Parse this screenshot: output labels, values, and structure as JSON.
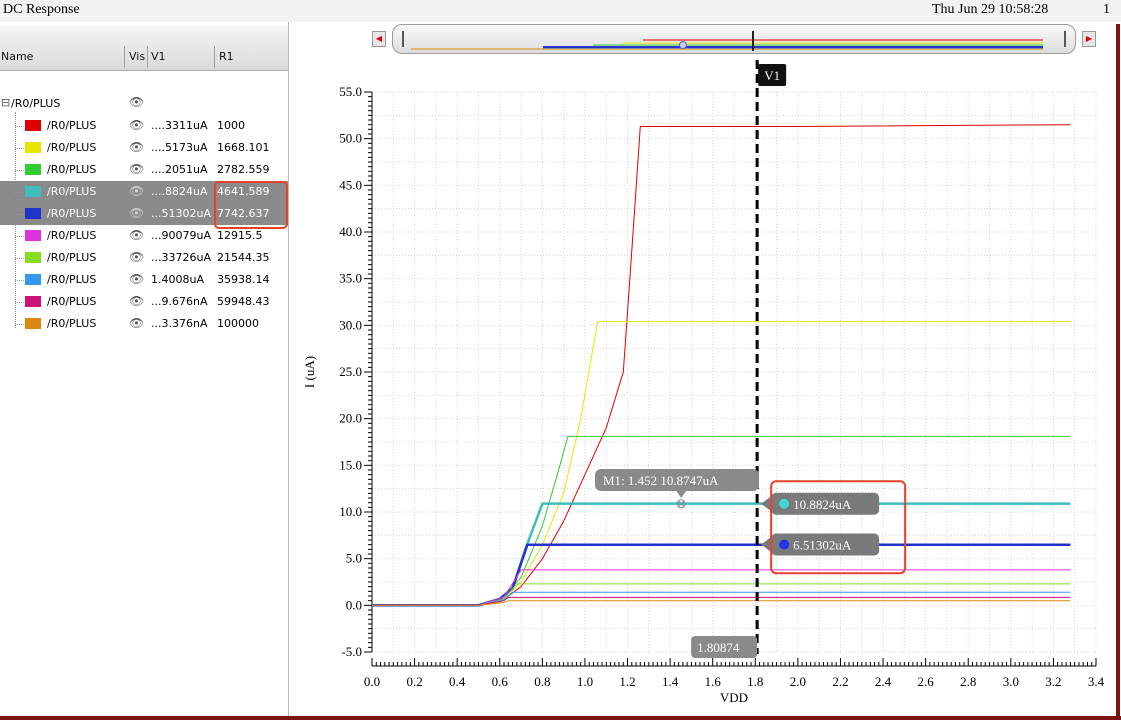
{
  "window": {
    "title": "DC Response",
    "datetime": "Thu Jun 29 10:58:28",
    "page_number": "1"
  },
  "table": {
    "columns": [
      "Name",
      "Vis",
      "V1",
      "R1"
    ],
    "root": {
      "name": "/R0/PLUS"
    },
    "rows": [
      {
        "name": "/R0/PLUS",
        "v1": "....3311uA",
        "r1": "1000",
        "color": "#dd0000",
        "selected": false
      },
      {
        "name": "/R0/PLUS",
        "v1": "....5173uA",
        "r1": "1668.101",
        "color": "#e6e600",
        "selected": false
      },
      {
        "name": "/R0/PLUS",
        "v1": "....2051uA",
        "r1": "2782.559",
        "color": "#33cc33",
        "selected": false
      },
      {
        "name": "/R0/PLUS",
        "v1": "....8824uA",
        "r1": "4641.589",
        "color": "#3dbdbd",
        "selected": true
      },
      {
        "name": "/R0/PLUS",
        "v1": "...51302uA",
        "r1": "7742.637",
        "color": "#2233cc",
        "selected": true
      },
      {
        "name": "/R0/PLUS",
        "v1": "...90079uA",
        "r1": "12915.5",
        "color": "#dd33dd",
        "selected": false
      },
      {
        "name": "/R0/PLUS",
        "v1": "...33726uA",
        "r1": "21544.35",
        "color": "#88dd22",
        "selected": false
      },
      {
        "name": "/R0/PLUS",
        "v1": "1.4008uA",
        "r1": "35938.14",
        "color": "#3399ee",
        "selected": false
      },
      {
        "name": "/R0/PLUS",
        "v1": "...9.676nA",
        "r1": "59948.43",
        "color": "#cc1177",
        "selected": false
      },
      {
        "name": "/R0/PLUS",
        "v1": "...3.376nA",
        "r1": "100000",
        "color": "#dd8811",
        "selected": false
      }
    ]
  },
  "cursor": {
    "label": "V1",
    "x_value_label": "1.80874"
  },
  "marker": {
    "label": "M1: 1.452 10.8747uA",
    "x": 1.452,
    "y": 10.8747
  },
  "cursor_readouts": [
    {
      "text": "10.8824uA",
      "y": 10.8824,
      "color": "#3dd6d6"
    },
    {
      "text": "6.51302uA",
      "y": 6.51302,
      "color": "#2233ee"
    }
  ],
  "chart_data": {
    "type": "line",
    "xlabel": "VDD",
    "ylabel": "I (uA)",
    "xlim": [
      0.0,
      3.4
    ],
    "ylim": [
      -5.0,
      55.0
    ],
    "x_ticks": [
      "0.0",
      "0.2",
      "0.4",
      "0.6",
      "0.8",
      "1.0",
      "1.2",
      "1.4",
      "1.6",
      "1.8",
      "2.0",
      "2.2",
      "2.4",
      "2.6",
      "2.8",
      "3.0",
      "3.2",
      "3.4"
    ],
    "y_ticks": [
      "-5.0",
      "0.0",
      "5.0",
      "10.0",
      "15.0",
      "20.0",
      "25.0",
      "30.0",
      "35.0",
      "40.0",
      "45.0",
      "50.0",
      "55.0"
    ],
    "grid": true,
    "series": [
      {
        "color": "#dd0000",
        "width": 1,
        "points": [
          [
            0,
            0
          ],
          [
            0.5,
            0
          ],
          [
            0.6,
            0.3
          ],
          [
            0.7,
            2
          ],
          [
            0.8,
            5
          ],
          [
            0.9,
            9
          ],
          [
            1.0,
            14
          ],
          [
            1.1,
            19
          ],
          [
            1.18,
            25
          ],
          [
            1.22,
            38
          ],
          [
            1.26,
            51.3
          ],
          [
            2.0,
            51.3
          ],
          [
            3.28,
            51.5
          ]
        ]
      },
      {
        "color": "#e6e600",
        "width": 1,
        "points": [
          [
            0,
            0
          ],
          [
            0.5,
            0
          ],
          [
            0.6,
            0.3
          ],
          [
            0.7,
            2.5
          ],
          [
            0.8,
            6.5
          ],
          [
            0.9,
            12
          ],
          [
            0.98,
            20
          ],
          [
            1.06,
            30.4
          ],
          [
            3.28,
            30.4
          ]
        ]
      },
      {
        "color": "#33cc33",
        "width": 1,
        "points": [
          [
            0,
            0
          ],
          [
            0.5,
            0
          ],
          [
            0.6,
            0.5
          ],
          [
            0.7,
            3
          ],
          [
            0.8,
            8.5
          ],
          [
            0.87,
            14
          ],
          [
            0.92,
            18.1
          ],
          [
            3.28,
            18.1
          ]
        ]
      },
      {
        "color": "#3dbdbd",
        "width": 2.5,
        "points": [
          [
            0,
            0
          ],
          [
            0.5,
            0
          ],
          [
            0.6,
            0.6
          ],
          [
            0.66,
            1.8
          ],
          [
            0.72,
            6
          ],
          [
            0.8,
            10.9
          ],
          [
            3.28,
            10.9
          ]
        ]
      },
      {
        "color": "#2233cc",
        "width": 2.5,
        "points": [
          [
            0,
            0
          ],
          [
            0.5,
            0
          ],
          [
            0.6,
            0.7
          ],
          [
            0.66,
            1.8
          ],
          [
            0.73,
            6.5
          ],
          [
            3.28,
            6.5
          ]
        ]
      },
      {
        "color": "#dd33dd",
        "width": 1,
        "points": [
          [
            0,
            0
          ],
          [
            0.5,
            0
          ],
          [
            0.62,
            0.9
          ],
          [
            0.7,
            3.8
          ],
          [
            3.28,
            3.8
          ]
        ]
      },
      {
        "color": "#88dd22",
        "width": 1,
        "points": [
          [
            0,
            0
          ],
          [
            0.5,
            0
          ],
          [
            0.62,
            0.7
          ],
          [
            0.68,
            2.3
          ],
          [
            3.28,
            2.3
          ]
        ]
      },
      {
        "color": "#3399ee",
        "width": 1,
        "points": [
          [
            0,
            0
          ],
          [
            0.5,
            0
          ],
          [
            0.62,
            0.6
          ],
          [
            0.66,
            1.4
          ],
          [
            3.28,
            1.4
          ]
        ]
      },
      {
        "color": "#cc1177",
        "width": 1,
        "points": [
          [
            0,
            0
          ],
          [
            0.5,
            0
          ],
          [
            0.62,
            0.5
          ],
          [
            0.64,
            0.85
          ],
          [
            3.28,
            0.85
          ]
        ]
      },
      {
        "color": "#dd8811",
        "width": 1,
        "points": [
          [
            0,
            0
          ],
          [
            0.5,
            0
          ],
          [
            0.62,
            0.3
          ],
          [
            0.64,
            0.5
          ],
          [
            3.28,
            0.5
          ]
        ]
      }
    ]
  }
}
